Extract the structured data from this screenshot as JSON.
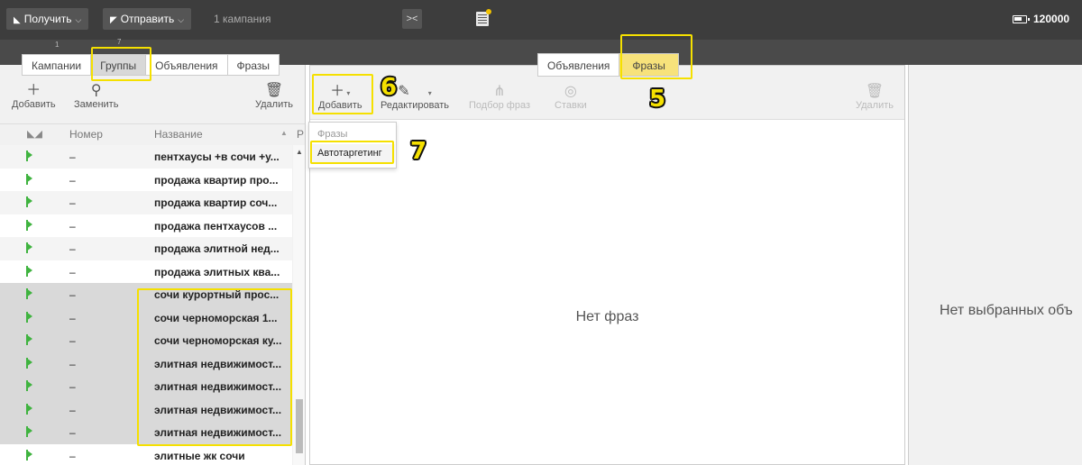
{
  "topbar": {
    "get_label": "Получить",
    "send_label": "Отправить",
    "campaign_count": "1 кампания",
    "balance": "120000"
  },
  "strip": {
    "n1": "1",
    "n7": "7"
  },
  "left": {
    "tabs": [
      {
        "label": "Кампании"
      },
      {
        "label": "Группы"
      },
      {
        "label": "Объявления"
      },
      {
        "label": "Фразы"
      }
    ],
    "toolbar": {
      "add_label": "Добавить",
      "replace_label": "Заменить",
      "delete_label": "Удалить"
    },
    "header": {
      "number": "Номер",
      "name": "Название",
      "r": "Р"
    },
    "rows": [
      {
        "num": "–",
        "name": "пентхаусы +в сочи +у..."
      },
      {
        "num": "–",
        "name": "продажа квартир про..."
      },
      {
        "num": "–",
        "name": "продажа квартир соч..."
      },
      {
        "num": "–",
        "name": "продажа пентхаусов ..."
      },
      {
        "num": "–",
        "name": "продажа элитной нед..."
      },
      {
        "num": "–",
        "name": "продажа элитных ква..."
      },
      {
        "num": "–",
        "name": "сочи курортный прос..."
      },
      {
        "num": "–",
        "name": "сочи черноморская 1..."
      },
      {
        "num": "–",
        "name": "сочи черноморская ку..."
      },
      {
        "num": "–",
        "name": "элитная недвижимост..."
      },
      {
        "num": "–",
        "name": "элитная недвижимост..."
      },
      {
        "num": "–",
        "name": "элитная недвижимост..."
      },
      {
        "num": "–",
        "name": "элитная недвижимост..."
      },
      {
        "num": "–",
        "name": "элитные жк сочи"
      }
    ]
  },
  "mid": {
    "tabs": [
      {
        "label": "Объявления"
      },
      {
        "label": "Фразы"
      }
    ],
    "toolbar": {
      "add_label": "Добавить",
      "edit_label": "Редактировать",
      "pick_label": "Подбор фраз",
      "bids_label": "Ставки",
      "delete_label": "Удалить"
    },
    "dropdown": {
      "section": "Фразы",
      "item": "Автотаргетинг"
    },
    "empty": "Нет фраз"
  },
  "right": {
    "empty": "Нет выбранных объ"
  },
  "annotations": {
    "n5": "5",
    "n6": "6",
    "n7": "7",
    "color": "#f5e000"
  }
}
